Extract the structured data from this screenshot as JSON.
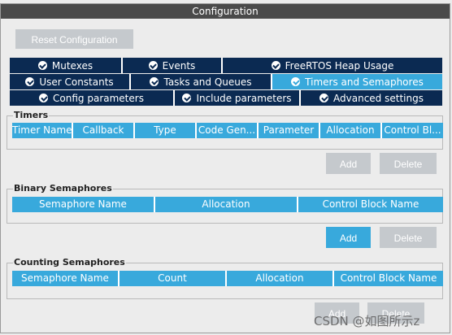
{
  "window": {
    "title": "Configuration"
  },
  "reset_button": "Reset Configuration",
  "tabs": {
    "row1": [
      {
        "label": "Mutexes",
        "active": false
      },
      {
        "label": "Events",
        "active": false
      },
      {
        "label": "FreeRTOS Heap Usage",
        "active": false
      }
    ],
    "row2": [
      {
        "label": "User Constants",
        "active": false
      },
      {
        "label": "Tasks and Queues",
        "active": false
      },
      {
        "label": "Timers and Semaphores",
        "active": true
      }
    ],
    "row3": [
      {
        "label": "Config parameters",
        "active": false
      },
      {
        "label": "Include parameters",
        "active": false
      },
      {
        "label": "Advanced settings",
        "active": false
      }
    ]
  },
  "timers": {
    "title": "Timers",
    "columns": [
      "Timer Name",
      "Callback",
      "Type",
      "Code Gen...",
      "Parameter",
      "Allocation",
      "Control Bl..."
    ],
    "add_label": "Add",
    "delete_label": "Delete"
  },
  "binary_semaphores": {
    "title": "Binary Semaphores",
    "columns": [
      "Semaphore Name",
      "Allocation",
      "Control Block Name"
    ],
    "add_label": "Add",
    "delete_label": "Delete"
  },
  "counting_semaphores": {
    "title": "Counting Semaphores",
    "columns": [
      "Semaphore Name",
      "Count",
      "Allocation",
      "Control Block Name"
    ],
    "add_label": "Add",
    "delete_label": "Delete"
  },
  "watermark": "CSDN @如图所示z",
  "colors": {
    "tab_dark": "#0b2a52",
    "accent": "#38a9dc",
    "disabled_button": "#c5c9cd",
    "title_bar": "#4a4a4a"
  }
}
